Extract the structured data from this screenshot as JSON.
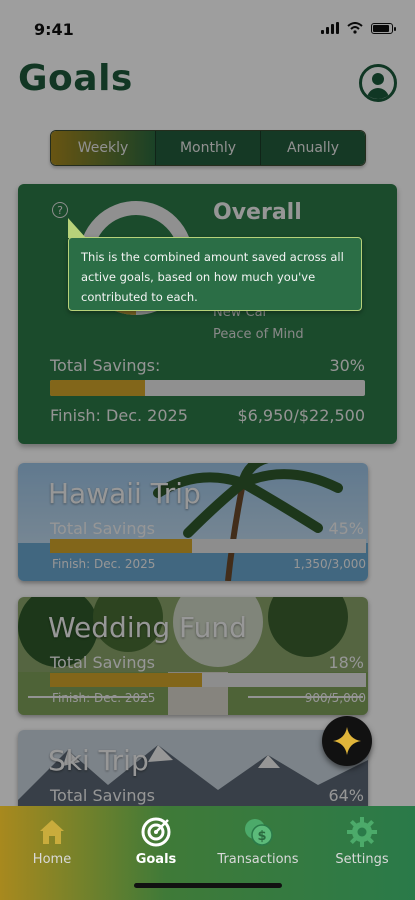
{
  "status_bar": {
    "time": "9:41"
  },
  "header": {
    "title": "Goals"
  },
  "segments": [
    "Weekly",
    "Monthly",
    "Anually"
  ],
  "overall": {
    "title": "Overall",
    "legend": [
      "New Car",
      "Peace of Mind"
    ],
    "total_label": "Total Savings:",
    "percent_text": "30%",
    "progress": 0.3,
    "finish": "Finish: Dec. 2025",
    "amount": "$6,950/$22,500"
  },
  "tooltip": {
    "text": "This is the combined amount saved across all active goals, based on how much you've contributed to each."
  },
  "goals": [
    {
      "name": "Hawaii Trip",
      "label": "Total Savings",
      "percent_text": "45%",
      "progress": 0.45,
      "finish": "Finish: Dec. 2025",
      "amount": "1,350/3,000"
    },
    {
      "name": "Wedding Fund",
      "label": "Total Savings",
      "percent_text": "18%",
      "progress": 0.48,
      "finish": "Finish: Dec. 2025",
      "amount": "900/5,000"
    },
    {
      "name": "Ski Trip",
      "label": "Total Savings",
      "percent_text": "64%"
    }
  ],
  "tabs": [
    {
      "label": "Home",
      "icon": "home-icon"
    },
    {
      "label": "Goals",
      "icon": "target-icon",
      "active": true
    },
    {
      "label": "Transactions",
      "icon": "coins-icon"
    },
    {
      "label": "Settings",
      "icon": "gear-icon"
    }
  ],
  "colors": {
    "primary_green": "#2c7a47",
    "accent_gold": "#d2a52a",
    "title_green": "#1e5a3a"
  }
}
